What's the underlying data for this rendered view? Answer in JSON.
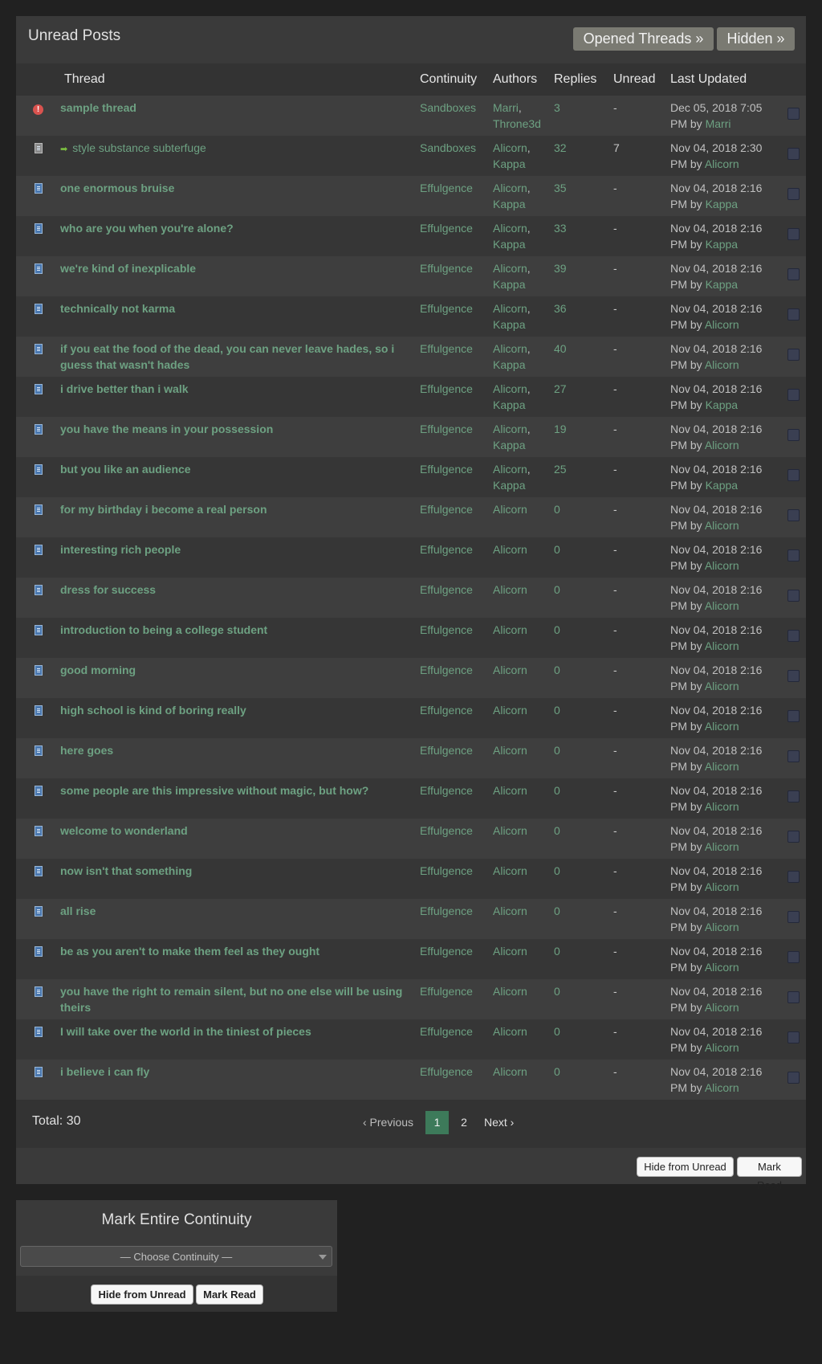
{
  "header": {
    "title": "Unread Posts",
    "opened_threads": "Opened Threads »",
    "hidden": "Hidden »"
  },
  "columns": {
    "thread": "Thread",
    "continuity": "Continuity",
    "authors": "Authors",
    "replies": "Replies",
    "unread": "Unread",
    "last_updated": "Last Updated"
  },
  "rows": [
    {
      "icon": "alert-icon",
      "title": "sample thread",
      "continuity": "Sandboxes",
      "authors": [
        "Marri",
        "Throne3d"
      ],
      "replies": "3",
      "unread": "-",
      "updated": "Dec 05, 2018 7:05 PM",
      "by": "Marri"
    },
    {
      "icon": "gray-document-icon",
      "title": "style substance subterfuge",
      "continuity": "Sandboxes",
      "authors": [
        "Alicorn",
        "Kappa"
      ],
      "replies": "32",
      "unread": "7",
      "updated": "Nov 04, 2018 2:30 PM",
      "by": "Alicorn"
    },
    {
      "icon": "document-icon",
      "title": "one enormous bruise",
      "continuity": "Effulgence",
      "authors": [
        "Alicorn",
        "Kappa"
      ],
      "replies": "35",
      "unread": "-",
      "updated": "Nov 04, 2018 2:16 PM",
      "by": "Kappa"
    },
    {
      "icon": "document-icon",
      "title": "who are you when you're alone?",
      "continuity": "Effulgence",
      "authors": [
        "Alicorn",
        "Kappa"
      ],
      "replies": "33",
      "unread": "-",
      "updated": "Nov 04, 2018 2:16 PM",
      "by": "Kappa"
    },
    {
      "icon": "document-icon",
      "title": "we're kind of inexplicable",
      "continuity": "Effulgence",
      "authors": [
        "Alicorn",
        "Kappa"
      ],
      "replies": "39",
      "unread": "-",
      "updated": "Nov 04, 2018 2:16 PM",
      "by": "Kappa"
    },
    {
      "icon": "document-icon",
      "title": "technically not karma",
      "continuity": "Effulgence",
      "authors": [
        "Alicorn",
        "Kappa"
      ],
      "replies": "36",
      "unread": "-",
      "updated": "Nov 04, 2018 2:16 PM",
      "by": "Alicorn"
    },
    {
      "icon": "document-icon",
      "title": "if you eat the food of the dead, you can never leave hades, so i guess that wasn't hades",
      "continuity": "Effulgence",
      "authors": [
        "Alicorn",
        "Kappa"
      ],
      "replies": "40",
      "unread": "-",
      "updated": "Nov 04, 2018 2:16 PM",
      "by": "Alicorn"
    },
    {
      "icon": "document-icon",
      "title": "i drive better than i walk",
      "continuity": "Effulgence",
      "authors": [
        "Alicorn",
        "Kappa"
      ],
      "replies": "27",
      "unread": "-",
      "updated": "Nov 04, 2018 2:16 PM",
      "by": "Kappa"
    },
    {
      "icon": "document-icon",
      "title": "you have the means in your possession",
      "continuity": "Effulgence",
      "authors": [
        "Alicorn",
        "Kappa"
      ],
      "replies": "19",
      "unread": "-",
      "updated": "Nov 04, 2018 2:16 PM",
      "by": "Alicorn"
    },
    {
      "icon": "document-icon",
      "title": "but you like an audience",
      "continuity": "Effulgence",
      "authors": [
        "Alicorn",
        "Kappa"
      ],
      "replies": "25",
      "unread": "-",
      "updated": "Nov 04, 2018 2:16 PM",
      "by": "Kappa"
    },
    {
      "icon": "document-icon",
      "title": "for my birthday i become a real person",
      "continuity": "Effulgence",
      "authors": [
        "Alicorn"
      ],
      "replies": "0",
      "unread": "-",
      "updated": "Nov 04, 2018 2:16 PM",
      "by": "Alicorn"
    },
    {
      "icon": "document-icon",
      "title": "interesting rich people",
      "continuity": "Effulgence",
      "authors": [
        "Alicorn"
      ],
      "replies": "0",
      "unread": "-",
      "updated": "Nov 04, 2018 2:16 PM",
      "by": "Alicorn"
    },
    {
      "icon": "document-icon",
      "title": "dress for success",
      "continuity": "Effulgence",
      "authors": [
        "Alicorn"
      ],
      "replies": "0",
      "unread": "-",
      "updated": "Nov 04, 2018 2:16 PM",
      "by": "Alicorn"
    },
    {
      "icon": "document-icon",
      "title": "introduction to being a college student",
      "continuity": "Effulgence",
      "authors": [
        "Alicorn"
      ],
      "replies": "0",
      "unread": "-",
      "updated": "Nov 04, 2018 2:16 PM",
      "by": "Alicorn"
    },
    {
      "icon": "document-icon",
      "title": "good morning",
      "continuity": "Effulgence",
      "authors": [
        "Alicorn"
      ],
      "replies": "0",
      "unread": "-",
      "updated": "Nov 04, 2018 2:16 PM",
      "by": "Alicorn"
    },
    {
      "icon": "document-icon",
      "title": "high school is kind of boring really",
      "continuity": "Effulgence",
      "authors": [
        "Alicorn"
      ],
      "replies": "0",
      "unread": "-",
      "updated": "Nov 04, 2018 2:16 PM",
      "by": "Alicorn"
    },
    {
      "icon": "document-icon",
      "title": "here goes",
      "continuity": "Effulgence",
      "authors": [
        "Alicorn"
      ],
      "replies": "0",
      "unread": "-",
      "updated": "Nov 04, 2018 2:16 PM",
      "by": "Alicorn"
    },
    {
      "icon": "document-icon",
      "title": "some people are this impressive without magic, but how?",
      "continuity": "Effulgence",
      "authors": [
        "Alicorn"
      ],
      "replies": "0",
      "unread": "-",
      "updated": "Nov 04, 2018 2:16 PM",
      "by": "Alicorn"
    },
    {
      "icon": "document-icon",
      "title": "welcome to wonderland",
      "continuity": "Effulgence",
      "authors": [
        "Alicorn"
      ],
      "replies": "0",
      "unread": "-",
      "updated": "Nov 04, 2018 2:16 PM",
      "by": "Alicorn"
    },
    {
      "icon": "document-icon",
      "title": "now isn't that something",
      "continuity": "Effulgence",
      "authors": [
        "Alicorn"
      ],
      "replies": "0",
      "unread": "-",
      "updated": "Nov 04, 2018 2:16 PM",
      "by": "Alicorn"
    },
    {
      "icon": "document-icon",
      "title": "all rise",
      "continuity": "Effulgence",
      "authors": [
        "Alicorn"
      ],
      "replies": "0",
      "unread": "-",
      "updated": "Nov 04, 2018 2:16 PM",
      "by": "Alicorn"
    },
    {
      "icon": "document-icon",
      "title": "be as you aren't to make them feel as they ought",
      "continuity": "Effulgence",
      "authors": [
        "Alicorn"
      ],
      "replies": "0",
      "unread": "-",
      "updated": "Nov 04, 2018 2:16 PM",
      "by": "Alicorn"
    },
    {
      "icon": "document-icon",
      "title": "you have the right to remain silent, but no one else will be using theirs",
      "continuity": "Effulgence",
      "authors": [
        "Alicorn"
      ],
      "replies": "0",
      "unread": "-",
      "updated": "Nov 04, 2018 2:16 PM",
      "by": "Alicorn"
    },
    {
      "icon": "document-icon",
      "title": "I will take over the world in the tiniest of pieces",
      "continuity": "Effulgence",
      "authors": [
        "Alicorn"
      ],
      "replies": "0",
      "unread": "-",
      "updated": "Nov 04, 2018 2:16 PM",
      "by": "Alicorn"
    },
    {
      "icon": "document-icon",
      "title": "i believe i can fly",
      "continuity": "Effulgence",
      "authors": [
        "Alicorn"
      ],
      "replies": "0",
      "unread": "-",
      "updated": "Nov 04, 2018 2:16 PM",
      "by": "Alicorn"
    }
  ],
  "by_label": "by",
  "footer": {
    "total": "Total: 30",
    "prev": "‹ Previous",
    "page_1": "1",
    "page_2": "2",
    "next": "Next ›",
    "current_page": 1
  },
  "actions": {
    "hide_from_unread": "Hide from Unread",
    "mark_read": "Mark Read"
  },
  "continuity_panel": {
    "title": "Mark Entire Continuity",
    "select_value": "— Choose Continuity —",
    "hide_from_unread": "Hide from Unread",
    "mark_read": "Mark Read"
  },
  "colors": {
    "link": "#6da182",
    "page_bg": "#212121",
    "active_page": "#3d7a5a"
  }
}
